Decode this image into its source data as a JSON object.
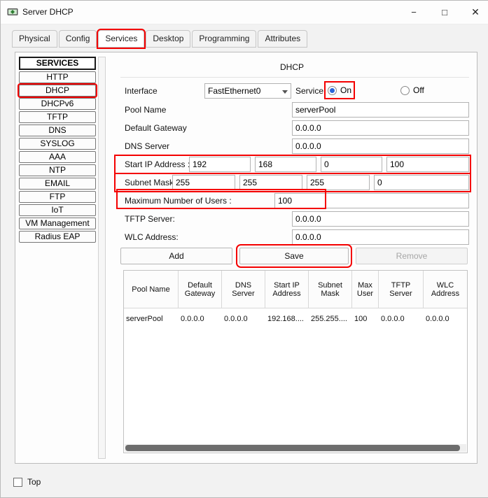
{
  "colors": {
    "annotation": "#f40000",
    "radio_selected": "#2a66d9"
  },
  "window": {
    "title": "Server DHCP",
    "controls": {
      "minimize": "−",
      "maximize": "□",
      "close": "✕"
    }
  },
  "tabs": [
    {
      "label": "Physical"
    },
    {
      "label": "Config"
    },
    {
      "label": "Services"
    },
    {
      "label": "Desktop"
    },
    {
      "label": "Programming"
    },
    {
      "label": "Attributes"
    }
  ],
  "sidebar": {
    "header": "SERVICES",
    "items": [
      {
        "label": "HTTP"
      },
      {
        "label": "DHCP"
      },
      {
        "label": "DHCPv6"
      },
      {
        "label": "TFTP"
      },
      {
        "label": "DNS"
      },
      {
        "label": "SYSLOG"
      },
      {
        "label": "AAA"
      },
      {
        "label": "NTP"
      },
      {
        "label": "EMAIL"
      },
      {
        "label": "FTP"
      },
      {
        "label": "IoT"
      },
      {
        "label": "VM Management"
      },
      {
        "label": "Radius EAP"
      }
    ]
  },
  "dhcp": {
    "title": "DHCP",
    "interface_label": "Interface",
    "interface_value": "FastEthernet0",
    "service_label": "Service",
    "service_on_label": "On",
    "service_off_label": "Off",
    "pool_name_label": "Pool Name",
    "pool_name_value": "serverPool",
    "default_gateway_label": "Default Gateway",
    "default_gateway_value": "0.0.0.0",
    "dns_server_label": "DNS Server",
    "dns_server_value": "0.0.0.0",
    "start_ip_label": "Start IP Address :",
    "start_ip_octets": [
      "192",
      "168",
      "0",
      "100"
    ],
    "subnet_mask_label": "Subnet Mask:",
    "subnet_mask_octets": [
      "255",
      "255",
      "255",
      "0"
    ],
    "max_users_label": "Maximum Number of Users :",
    "max_users_value": "100",
    "tftp_label": "TFTP Server:",
    "tftp_value": "0.0.0.0",
    "wlc_label": "WLC Address:",
    "wlc_value": "0.0.0.0",
    "add_label": "Add",
    "save_label": "Save",
    "remove_label": "Remove",
    "table": {
      "headers": [
        "Pool Name",
        "Default Gateway",
        "DNS Server",
        "Start IP Address",
        "Subnet Mask",
        "Max User",
        "TFTP Server",
        "WLC Address"
      ],
      "rows": [
        [
          "serverPool",
          "0.0.0.0",
          "0.0.0.0",
          "192.168....",
          "255.255....",
          "100",
          "0.0.0.0",
          "0.0.0.0"
        ]
      ]
    }
  },
  "footer": {
    "top_label": "Top"
  }
}
